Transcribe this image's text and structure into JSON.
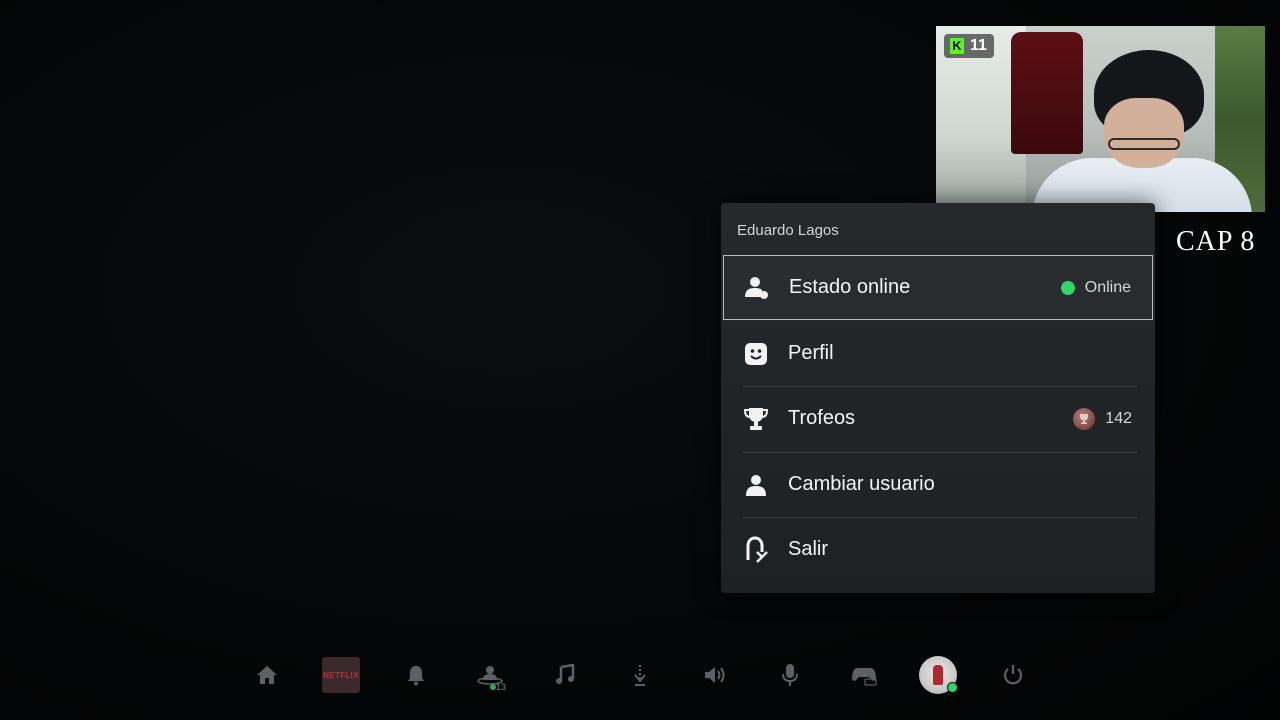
{
  "overlay": {
    "viewer_count": "11",
    "chapter_label": "CAP 8"
  },
  "menu": {
    "user_name": "Eduardo Lagos",
    "items": [
      {
        "label": "Estado online",
        "icon": "user-status-icon",
        "right_text": "Online",
        "status_color": "#2fd668",
        "selected": true
      },
      {
        "label": "Perfil",
        "icon": "profile-face-icon"
      },
      {
        "label": "Trofeos",
        "icon": "trophy-icon",
        "right_text": "142"
      },
      {
        "label": "Cambiar usuario",
        "icon": "user-icon"
      },
      {
        "label": "Salir",
        "icon": "exit-icon"
      }
    ]
  },
  "control_bar": {
    "items": [
      "home-icon",
      "netflix-tile",
      "bell-icon",
      "friends-icon",
      "music-icon",
      "download-icon",
      "speaker-icon",
      "microphone-icon",
      "controller-icon",
      "user-avatar",
      "power-icon"
    ],
    "netflix_label": "NETFLIX",
    "friends_online_count": "13"
  },
  "colors": {
    "online_green": "#2fd668",
    "panel_bg": "#232628",
    "kick_green": "#53fc18"
  }
}
